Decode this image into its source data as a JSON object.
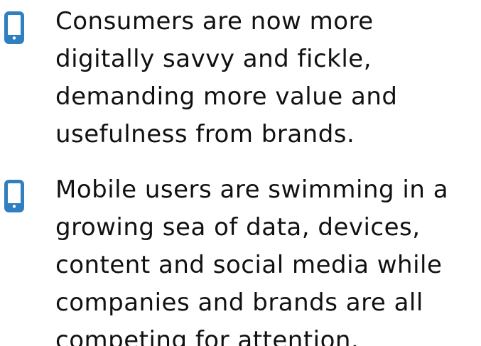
{
  "bullets": [
    {
      "icon": "mobile-phone-icon",
      "lines": [
        "Consumers are now more",
        "digitally savvy and fickle,",
        "demanding more value and",
        "usefulness from brands."
      ]
    },
    {
      "icon": "mobile-phone-icon",
      "lines": [
        "Mobile users are swimming in a",
        "growing sea of data, devices,",
        "content and social media while",
        "companies and brands are all",
        "competing for attention."
      ]
    }
  ],
  "colors": {
    "icon_blue": "#2F7FC1",
    "text": "#111111",
    "background": "#FFFFFF"
  }
}
